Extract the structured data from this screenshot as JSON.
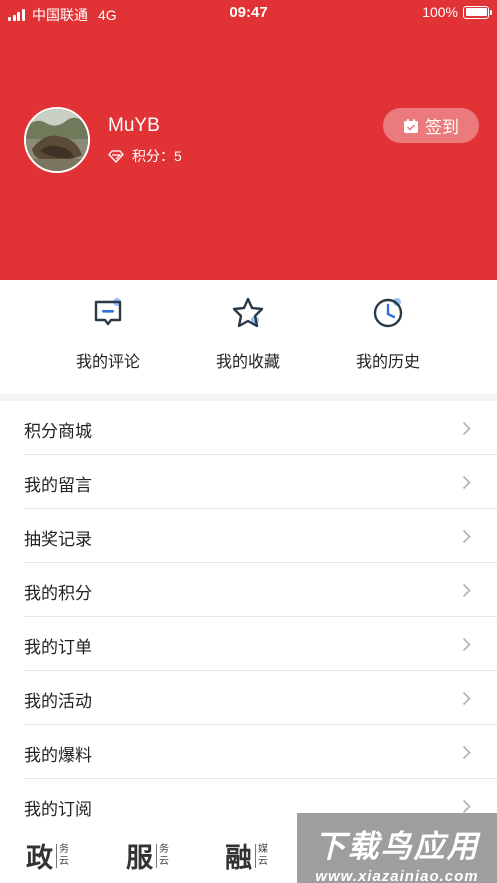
{
  "status_bar": {
    "carrier": "中国联通",
    "network": "4G",
    "time": "09:47",
    "battery": "100%"
  },
  "profile": {
    "username": "MuYB",
    "points_label": "积分：",
    "points_value": "5",
    "checkin_label": "签到"
  },
  "quick_actions": [
    {
      "label": "我的评论",
      "icon": "comment-icon"
    },
    {
      "label": "我的收藏",
      "icon": "star-icon"
    },
    {
      "label": "我的历史",
      "icon": "clock-icon"
    }
  ],
  "menu": [
    {
      "label": "积分商城"
    },
    {
      "label": "我的留言"
    },
    {
      "label": "抽奖记录"
    },
    {
      "label": "我的积分"
    },
    {
      "label": "我的订单"
    },
    {
      "label": "我的活动"
    },
    {
      "label": "我的爆料"
    },
    {
      "label": "我的订阅"
    }
  ],
  "tabbar": [
    {
      "big": "政",
      "sub": "务云"
    },
    {
      "big": "服",
      "sub": "务云"
    },
    {
      "big": "融",
      "sub": "媒云"
    }
  ],
  "watermark": {
    "title": "下载鸟应用",
    "url": "www.xiazainiao.com"
  },
  "colors": {
    "brand_red": "#e13336",
    "icon_dark": "#2b3a48",
    "icon_accent": "#9cc3f5"
  }
}
